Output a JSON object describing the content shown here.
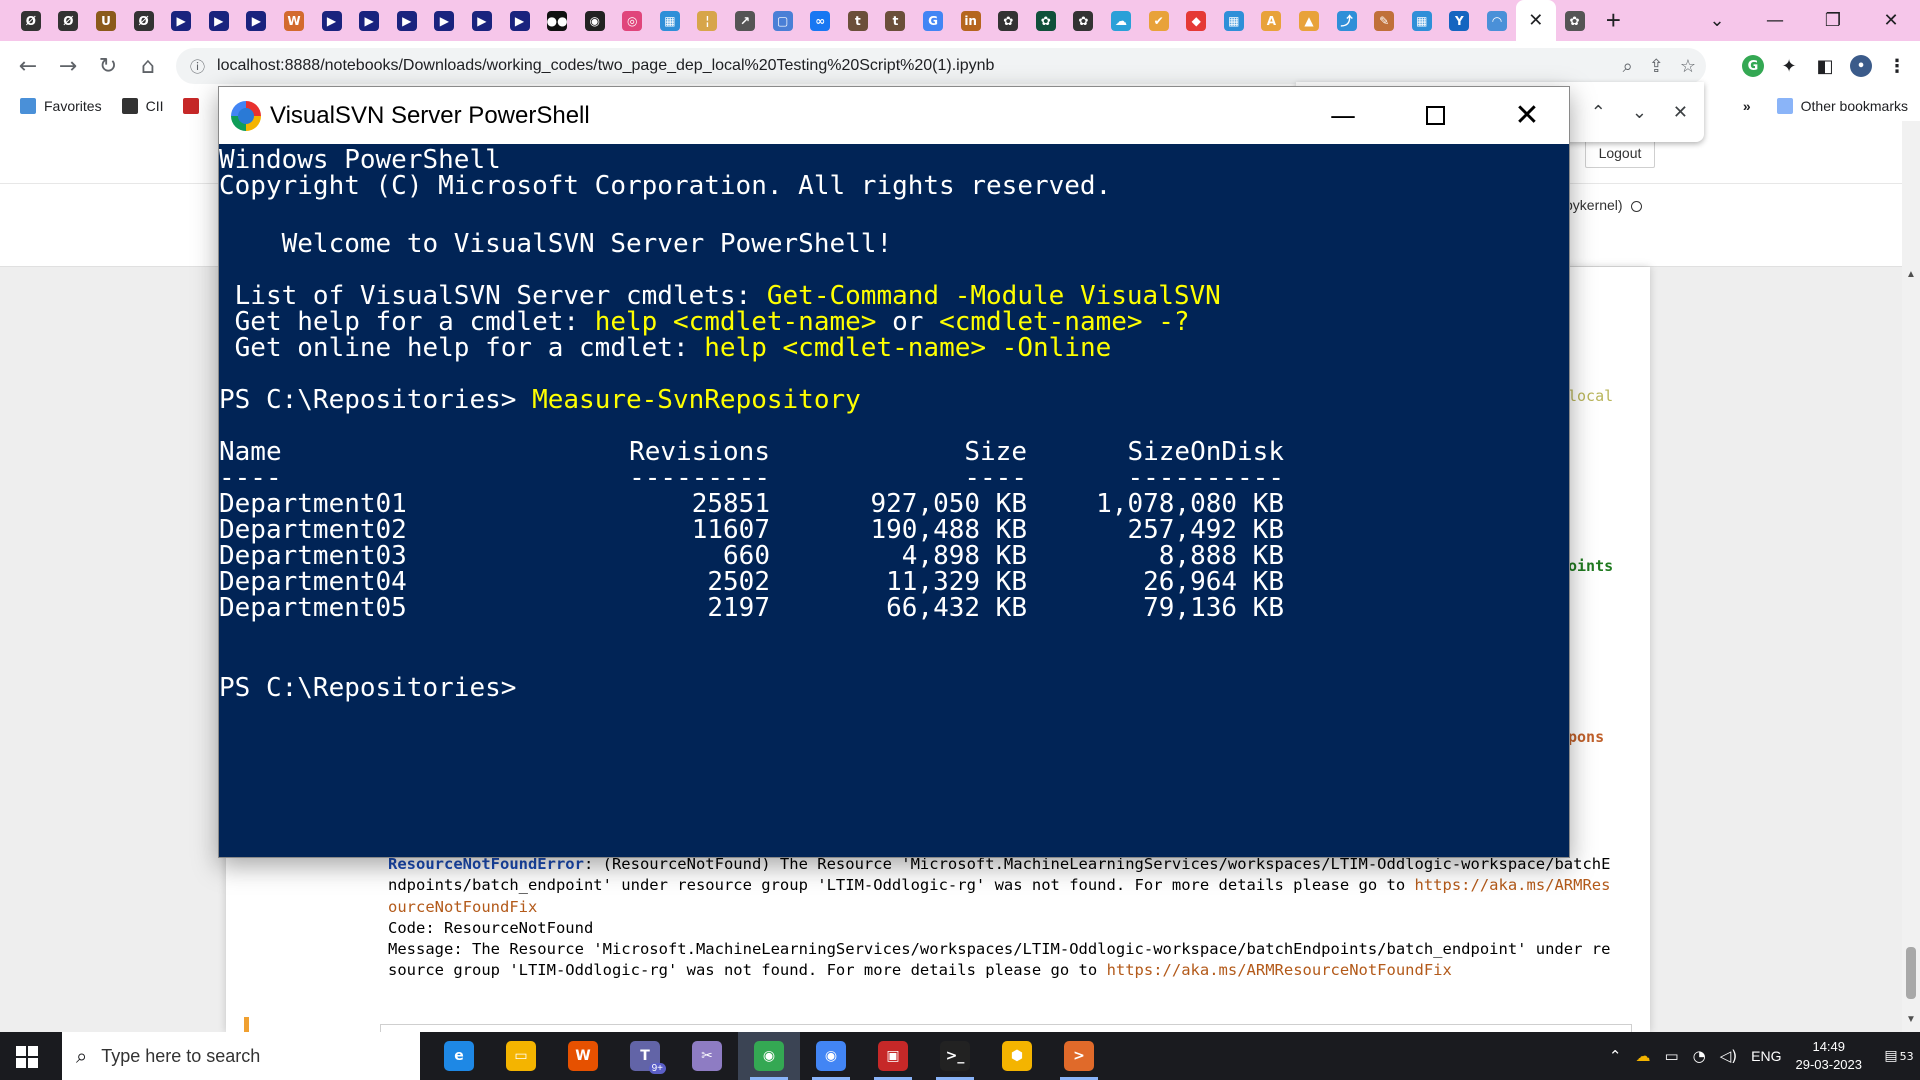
{
  "browser": {
    "tab_favicons": [
      {
        "name": "tab-favicon-lt",
        "glyph": "Ø",
        "color": "#333333"
      },
      {
        "name": "tab-favicon-lt-2",
        "glyph": "Ø",
        "color": "#333333"
      },
      {
        "name": "tab-favicon-u",
        "glyph": "U",
        "color": "#8b5a1a"
      },
      {
        "name": "tab-favicon-lt-3",
        "glyph": "Ø",
        "color": "#333333"
      },
      {
        "name": "tab-favicon-youtube",
        "glyph": "▶",
        "color": "#1a237e"
      },
      {
        "name": "tab-favicon-youtube-2",
        "glyph": "▶",
        "color": "#1a237e"
      },
      {
        "name": "tab-favicon-youtube-3",
        "glyph": "▶",
        "color": "#1a237e"
      },
      {
        "name": "tab-favicon-wordpress",
        "glyph": "W",
        "color": "#d36a2e"
      },
      {
        "name": "tab-favicon-youtube-4",
        "glyph": "▶",
        "color": "#1a237e"
      },
      {
        "name": "tab-favicon-youtube-5",
        "glyph": "▶",
        "color": "#1a237e"
      },
      {
        "name": "tab-favicon-youtube-6",
        "glyph": "▶",
        "color": "#1a237e"
      },
      {
        "name": "tab-favicon-youtube-7",
        "glyph": "▶",
        "color": "#1a237e"
      },
      {
        "name": "tab-favicon-youtube-8",
        "glyph": "▶",
        "color": "#1a237e"
      },
      {
        "name": "tab-favicon-youtube-9",
        "glyph": "▶",
        "color": "#1a237e"
      },
      {
        "name": "tab-favicon-medium",
        "glyph": "●●",
        "color": "#111111"
      },
      {
        "name": "tab-favicon-github",
        "glyph": "◉",
        "color": "#222222"
      },
      {
        "name": "tab-favicon-instagram",
        "glyph": "◎",
        "color": "#e0457b"
      },
      {
        "name": "tab-favicon-microsoft",
        "glyph": "▦",
        "color": "#2f8fd8"
      },
      {
        "name": "tab-favicon-tool",
        "glyph": "¦",
        "color": "#d7a54a"
      },
      {
        "name": "tab-favicon-chart",
        "glyph": "↗",
        "color": "#555555"
      },
      {
        "name": "tab-favicon-doc",
        "glyph": "▢",
        "color": "#4a7fd6"
      },
      {
        "name": "tab-favicon-meta",
        "glyph": "∞",
        "color": "#1877f2"
      },
      {
        "name": "tab-favicon-tds",
        "glyph": "t",
        "color": "#6b4f3a"
      },
      {
        "name": "tab-favicon-tds-2",
        "glyph": "t",
        "color": "#6b4f3a"
      },
      {
        "name": "tab-favicon-google",
        "glyph": "G",
        "color": "#4285f4"
      },
      {
        "name": "tab-favicon-linkedin",
        "glyph": "in",
        "color": "#b5651d"
      },
      {
        "name": "tab-favicon-openai",
        "glyph": "✿",
        "color": "#333333"
      },
      {
        "name": "tab-favicon-openai-2",
        "glyph": "✿",
        "color": "#10503a"
      },
      {
        "name": "tab-favicon-openai-3",
        "glyph": "✿",
        "color": "#333333"
      },
      {
        "name": "tab-favicon-bot",
        "glyph": "☁",
        "color": "#2aa0d8"
      },
      {
        "name": "tab-favicon-twitter",
        "glyph": "✔",
        "color": "#e8a23a"
      },
      {
        "name": "tab-favicon-red",
        "glyph": "◆",
        "color": "#e53935"
      },
      {
        "name": "tab-favicon-microsoft-2",
        "glyph": "▦",
        "color": "#2f8fd8"
      },
      {
        "name": "tab-favicon-a",
        "glyph": "A",
        "color": "#e8a23a"
      },
      {
        "name": "tab-favicon-flask",
        "glyph": "▲",
        "color": "#e8a23a"
      },
      {
        "name": "tab-favicon-azure",
        "glyph": "⤴",
        "color": "#2f8fd8"
      },
      {
        "name": "tab-favicon-kite",
        "glyph": "✎",
        "color": "#c0703a"
      },
      {
        "name": "tab-favicon-microsoft-3",
        "glyph": "▦",
        "color": "#2f8fd8"
      },
      {
        "name": "tab-favicon-yahoo",
        "glyph": "Y",
        "color": "#1565c0"
      },
      {
        "name": "tab-favicon-loading",
        "glyph": "◠",
        "color": "#4a90d8"
      }
    ],
    "active_tab_close": "✕",
    "new_tab": "+",
    "window_controls": {
      "collapse": "⌄",
      "minimize": "—",
      "restore": "❐",
      "close": "✕"
    },
    "nav": {
      "back": "←",
      "forward": "→",
      "reload": "↻",
      "home": "⌂"
    },
    "url": "localhost:8888/notebooks/Downloads/working_codes/two_page_dep_local%20Testing%20Script%20(1).ipynb",
    "bookmarks": [
      {
        "label": "Favorites",
        "color": "#4a90d8"
      },
      {
        "label": "CII",
        "color": "#333333"
      },
      {
        "label": "",
        "color": "#c62828"
      }
    ],
    "bookmarks_overflow": "»",
    "other_bookmarks": "Other bookmarks",
    "find_bar": {
      "up": "⌃",
      "down": "⌄",
      "close": "✕"
    }
  },
  "jupyter": {
    "logout_label": "Logout",
    "kernel_label": "pykernel)",
    "fragments": {
      "local": "local",
      "points": "oints",
      "respons": "pons"
    },
    "output": {
      "error_name": "ResourceNotFoundError",
      "error_line1": ": (ResourceNotFound) The Resource 'Microsoft.MachineLearningServices/workspaces/LTIM-Oddlogic-workspace/batchEndpoints/batch_endpoint' under resource group 'LTIM-Oddlogic-rg' was not found. For more details please go to ",
      "error_link1": "https://aka.ms/ARMResourceNotFoundFix",
      "code_line": "Code: ResourceNotFound",
      "message_line": "Message: The Resource 'Microsoft.MachineLearningServices/workspaces/LTIM-Oddlogic-workspace/batchEndpoints/batch_endpoint' under resource group 'LTIM-Oddlogic-rg' was not found. For more details please go to ",
      "error_link2": "https://aka.ms/ARMResourceNotFoundFix"
    }
  },
  "powershell": {
    "title": "VisualSVN Server PowerShell",
    "controls": {
      "minimize": "—",
      "close": "✕"
    },
    "lines": {
      "header1": "Windows PowerShell",
      "header2": "Copyright (C) Microsoft Corporation. All rights reserved.",
      "welcome": "    Welcome to VisualSVN Server PowerShell!",
      "list_prefix": " List of VisualSVN Server cmdlets: ",
      "list_cmd": "Get-Command -Module VisualSVN",
      "help_prefix": " Get help for a cmdlet: ",
      "help_cmd1": "help <cmdlet-name>",
      "help_or": " or ",
      "help_cmd2": "<cmdlet-name> -?",
      "online_prefix": " Get online help for a cmdlet: ",
      "online_cmd": "help <cmdlet-name> -Online",
      "prompt1": "PS C:\\Repositories> ",
      "command1": "Measure-SvnRepository",
      "prompt2": "PS C:\\Repositories>"
    },
    "table": {
      "headers": [
        "Name",
        "Revisions",
        "Size",
        "SizeOnDisk"
      ],
      "underlines": [
        "----",
        "---------",
        "----",
        "----------"
      ],
      "rows": [
        [
          "Department01",
          "25851",
          "927,050 KB",
          "1,078,080 KB"
        ],
        [
          "Department02",
          "11607",
          "190,488 KB",
          "257,492 KB"
        ],
        [
          "Department03",
          "660",
          "4,898 KB",
          "8,888 KB"
        ],
        [
          "Department04",
          "2502",
          "11,329 KB",
          "26,964 KB"
        ],
        [
          "Department05",
          "2197",
          "66,432 KB",
          "79,136 KB"
        ]
      ]
    }
  },
  "taskbar": {
    "search_placeholder": "Type here to search",
    "apps": [
      {
        "name": "taskbar-edge",
        "glyph": "e",
        "color": "#1e88e5",
        "state": "normal"
      },
      {
        "name": "taskbar-file-explorer",
        "glyph": "▭",
        "color": "#f4b400",
        "state": "normal"
      },
      {
        "name": "taskbar-wps",
        "glyph": "W",
        "color": "#e65100",
        "state": "normal"
      },
      {
        "name": "taskbar-teams",
        "glyph": "T",
        "color": "#6264a7",
        "state": "normal"
      },
      {
        "name": "taskbar-snipping",
        "glyph": "✂",
        "color": "#8e7cc3",
        "state": "normal"
      },
      {
        "name": "taskbar-chrome",
        "glyph": "◉",
        "color": "#34a853",
        "state": "active"
      },
      {
        "name": "taskbar-chrome-profile",
        "glyph": "◉",
        "color": "#4285f4",
        "state": "running"
      },
      {
        "name": "taskbar-svn",
        "glyph": "▣",
        "color": "#c62828",
        "state": "running"
      },
      {
        "name": "taskbar-terminal",
        "glyph": ">_",
        "color": "#222222",
        "state": "running"
      },
      {
        "name": "taskbar-box",
        "glyph": "⬢",
        "color": "#f4b400",
        "state": "normal"
      },
      {
        "name": "taskbar-powershell",
        "glyph": ">",
        "color": "#e06a2a",
        "state": "running"
      }
    ],
    "teams_badge": "9+",
    "tray": {
      "chevron": "⌃",
      "language": "ENG",
      "time": "14:49",
      "date": "29-03-2023",
      "notification_count": "53"
    }
  }
}
